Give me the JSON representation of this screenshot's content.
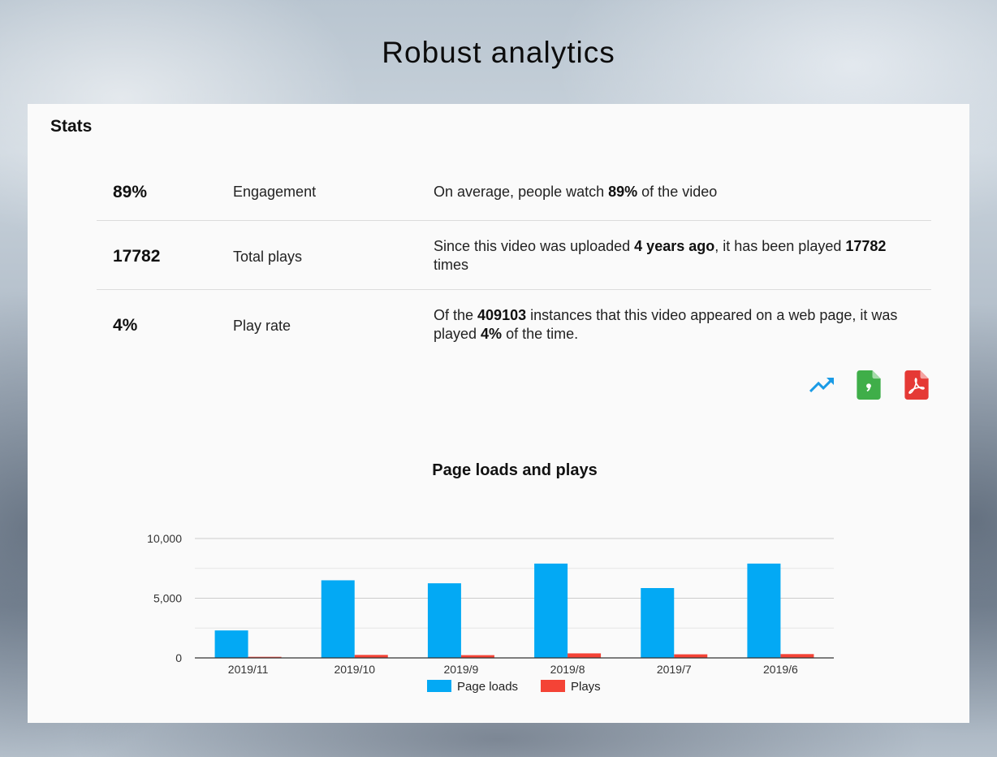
{
  "page": {
    "heading": "Robust analytics"
  },
  "panel": {
    "title": "Stats"
  },
  "stats": [
    {
      "value": "89%",
      "label": "Engagement",
      "desc": [
        {
          "t": "On average, people watch "
        },
        {
          "t": "89%",
          "b": true
        },
        {
          "t": " of the video"
        }
      ]
    },
    {
      "value": "17782",
      "label": "Total plays",
      "desc": [
        {
          "t": "Since this video was uploaded "
        },
        {
          "t": "4 years ago",
          "b": true
        },
        {
          "t": ", it has been played "
        },
        {
          "t": "17782",
          "b": true
        },
        {
          "t": " times"
        }
      ]
    },
    {
      "value": "4%",
      "label": "Play rate",
      "desc": [
        {
          "t": "Of the "
        },
        {
          "t": "409103",
          "b": true
        },
        {
          "t": " instances that this video appeared on a web page, it was played "
        },
        {
          "t": "4%",
          "b": true
        },
        {
          "t": " of the time."
        }
      ]
    }
  ],
  "toolbar": {
    "icons": [
      "trending-up-icon",
      "csv-file-icon",
      "pdf-file-icon"
    ],
    "colors": {
      "trend": "#1a9be6",
      "csv": "#3fae49",
      "pdf": "#e53935"
    }
  },
  "chart_data": {
    "type": "bar",
    "title": "Page loads and plays",
    "categories": [
      "2019/11",
      "2019/10",
      "2019/9",
      "2019/8",
      "2019/7",
      "2019/6"
    ],
    "series": [
      {
        "name": "Page loads",
        "color": "#03a9f4",
        "values": [
          2300,
          6500,
          6250,
          7900,
          5850,
          7900
        ]
      },
      {
        "name": "Plays",
        "color": "#f44336",
        "values": [
          90,
          250,
          230,
          380,
          300,
          320
        ]
      }
    ],
    "ylim": [
      0,
      10000
    ],
    "yticks": [
      "0",
      "5,000",
      "10,000"
    ],
    "ytick_values": [
      0,
      5000,
      10000
    ],
    "gridlines": true,
    "legend": "bottom"
  }
}
